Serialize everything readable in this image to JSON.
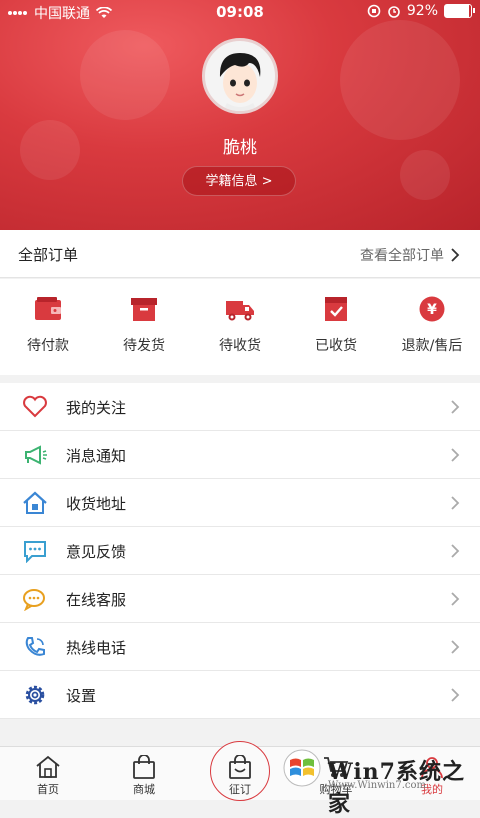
{
  "status_bar": {
    "carrier": "中国联通",
    "time": "09:08",
    "battery_percent": "92%",
    "battery_level": 0.92
  },
  "profile": {
    "name": "脆桃",
    "student_info_button": "学籍信息  >"
  },
  "orders": {
    "title": "全部订单",
    "view_all": "查看全部订单",
    "items": [
      {
        "label": "待付款",
        "icon": "wallet-icon"
      },
      {
        "label": "待发货",
        "icon": "box-icon"
      },
      {
        "label": "待收货",
        "icon": "truck-icon"
      },
      {
        "label": "已收货",
        "icon": "received-box-icon"
      },
      {
        "label": "退款/售后",
        "icon": "yen-icon"
      }
    ]
  },
  "menu": [
    {
      "label": "我的关注",
      "icon": "heart-icon"
    },
    {
      "label": "消息通知",
      "icon": "megaphone-icon"
    },
    {
      "label": "收货地址",
      "icon": "house-icon"
    },
    {
      "label": "意见反馈",
      "icon": "chat-bubble-icon"
    },
    {
      "label": "在线客服",
      "icon": "service-chat-icon"
    },
    {
      "label": "热线电话",
      "icon": "phone-icon"
    },
    {
      "label": "设置",
      "icon": "gear-icon"
    }
  ],
  "tabbar": [
    {
      "label": "首页",
      "icon": "home-icon"
    },
    {
      "label": "商城",
      "icon": "shopping-bag-icon"
    },
    {
      "label": "征订",
      "icon": "order-bag-icon"
    },
    {
      "label": "购物车",
      "icon": "cart-icon"
    },
    {
      "label": "我的",
      "icon": "user-icon"
    }
  ],
  "watermark": {
    "text": "Win7系统之家",
    "sub": "Www.Winwin7.com"
  },
  "colors": {
    "brand_red": "#d93a3f",
    "header_dark": "#b8242b",
    "accent_green": "#3cb371",
    "accent_blue": "#3a86d4",
    "accent_orange": "#e8a020"
  }
}
